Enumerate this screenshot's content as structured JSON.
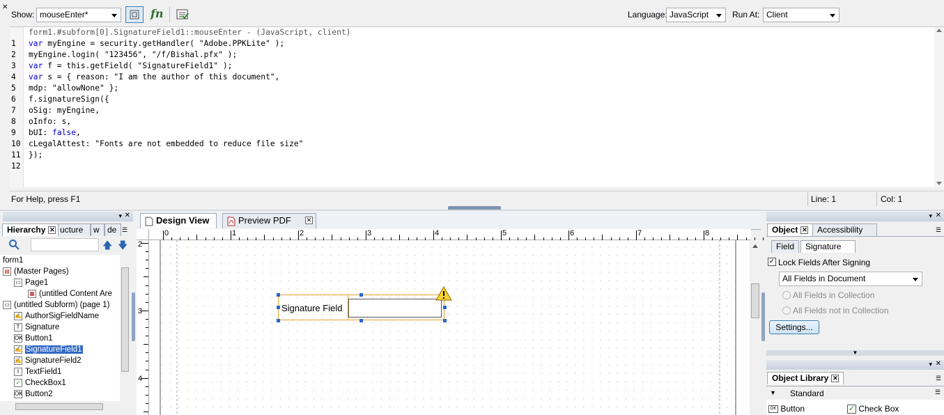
{
  "toolbar": {
    "show_label": "Show:",
    "show_value": "mouseEnter*",
    "language_label": "Language:",
    "language_value": "JavaScript",
    "run_at_label": "Run At:",
    "run_at_value": "Client"
  },
  "script": {
    "header": "form1.#subform[0].SignatureField1::mouseEnter - (JavaScript, client)",
    "lines": [
      {
        "n": "1",
        "text": "var myEngine = security.getHandler( \"Adobe.PPKLite\" );"
      },
      {
        "n": "2",
        "text": "myEngine.login( \"123456\", \"/f/Bishal.pfx\" );"
      },
      {
        "n": "3",
        "text": "var f = this.getField( \"SignatureField1\" );"
      },
      {
        "n": "4",
        "text": "var s = { reason: \"I am the author of this document\","
      },
      {
        "n": "5",
        "text": "mdp: \"allowNone\" };"
      },
      {
        "n": "6",
        "text": "f.signatureSign({"
      },
      {
        "n": "7",
        "text": "oSig: myEngine,"
      },
      {
        "n": "8",
        "text": "oInfo: s,"
      },
      {
        "n": "9",
        "text": "bUI: false,"
      },
      {
        "n": "10",
        "text": "cLegalAttest: \"Fonts are not embedded to reduce file size\""
      },
      {
        "n": "11",
        "text": "});"
      },
      {
        "n": "12",
        "text": ""
      }
    ]
  },
  "status": {
    "help": "For Help, press F1",
    "line": "Line: 1",
    "col": "Col: 1"
  },
  "hierarchy": {
    "tab_label": "Hierarchy",
    "tab2_label": "ucture",
    "tab3_label": "w",
    "tab4_label": "de",
    "items": [
      {
        "label": "form1",
        "icon": "none"
      },
      {
        "label": "(Master Pages)",
        "icon": "master-pages-icon"
      },
      {
        "label": "Page1",
        "icon": "page-icon"
      },
      {
        "label": "(untitled Content Are",
        "icon": "content-area-icon"
      },
      {
        "label": "(untitled Subform) (page 1)",
        "icon": "subform-icon"
      },
      {
        "label": "AuthorSigFieldName",
        "icon": "signature-field-icon"
      },
      {
        "label": "Signature",
        "icon": "text-icon"
      },
      {
        "label": "Button1",
        "icon": "button-icon"
      },
      {
        "label": "SignatureField1",
        "icon": "signature-field-icon"
      },
      {
        "label": "SignatureField2",
        "icon": "signature-field-icon"
      },
      {
        "label": "TextField1",
        "icon": "text-field-icon"
      },
      {
        "label": "CheckBox1",
        "icon": "checkbox-icon"
      },
      {
        "label": "Button2",
        "icon": "button-icon"
      }
    ]
  },
  "design": {
    "tab_design": "Design View",
    "tab_preview": "Preview PDF",
    "ruler_h": [
      "0",
      "1",
      "2",
      "3",
      "4",
      "5",
      "6",
      "7",
      "8"
    ],
    "ruler_v": [
      "2",
      "3",
      "4"
    ],
    "field_caption": "Signature Field"
  },
  "object": {
    "tab_object": "Object",
    "tab_accessibility": "Accessibility",
    "subtab_field": "Field",
    "subtab_signature": "Signature",
    "lock_label": "Lock Fields After Signing",
    "lock_checked": true,
    "scope_value": "All Fields in Document",
    "radio1": "All Fields in Collection",
    "radio2": "All Fields not in Collection",
    "settings_button": "Settings..."
  },
  "library": {
    "tab": "Object Library",
    "category": "Standard",
    "item1": "Button",
    "item2": "Check Box"
  }
}
